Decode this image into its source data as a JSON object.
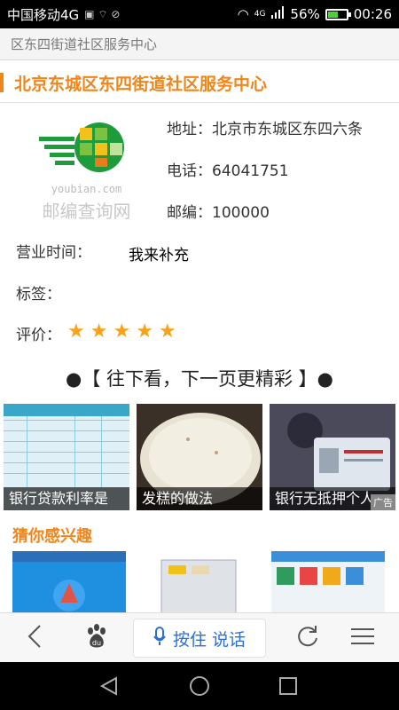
{
  "status": {
    "carrier": "中国移动4G",
    "network": "4G",
    "battery": "56%",
    "battery_level": 0.56,
    "time": "00:26"
  },
  "browser": {
    "title": "区东四街道社区服务中心"
  },
  "page": {
    "heading": "北京东城区东四街道社区服务中心",
    "logo": {
      "site": "youbian.com",
      "caption": "邮编查询网"
    },
    "address_label": "地址：",
    "address_value": "北京市东城区东四六条",
    "phone_label": "电话：",
    "phone_value": "64041751",
    "zip_label": "邮编：",
    "zip_value": "100000",
    "hours_label": "营业时间：",
    "hours_value": "我来补充",
    "tags_label": "标签：",
    "rating_label": "评价：",
    "rating_value": 5,
    "more_text": "●【 往下看，下一页更精彩 】●",
    "cards": [
      {
        "caption": "银行贷款利率是"
      },
      {
        "caption": "发糕的做法"
      },
      {
        "caption": "银行无抵押个人",
        "ad": "广告"
      }
    ],
    "interest_heading": "猜你感兴趣"
  },
  "nav": {
    "voice_label": "按住 说话"
  },
  "colors": {
    "accent": "#f08519",
    "star": "#f7a21b",
    "voice_blue": "#2a6fd6"
  }
}
